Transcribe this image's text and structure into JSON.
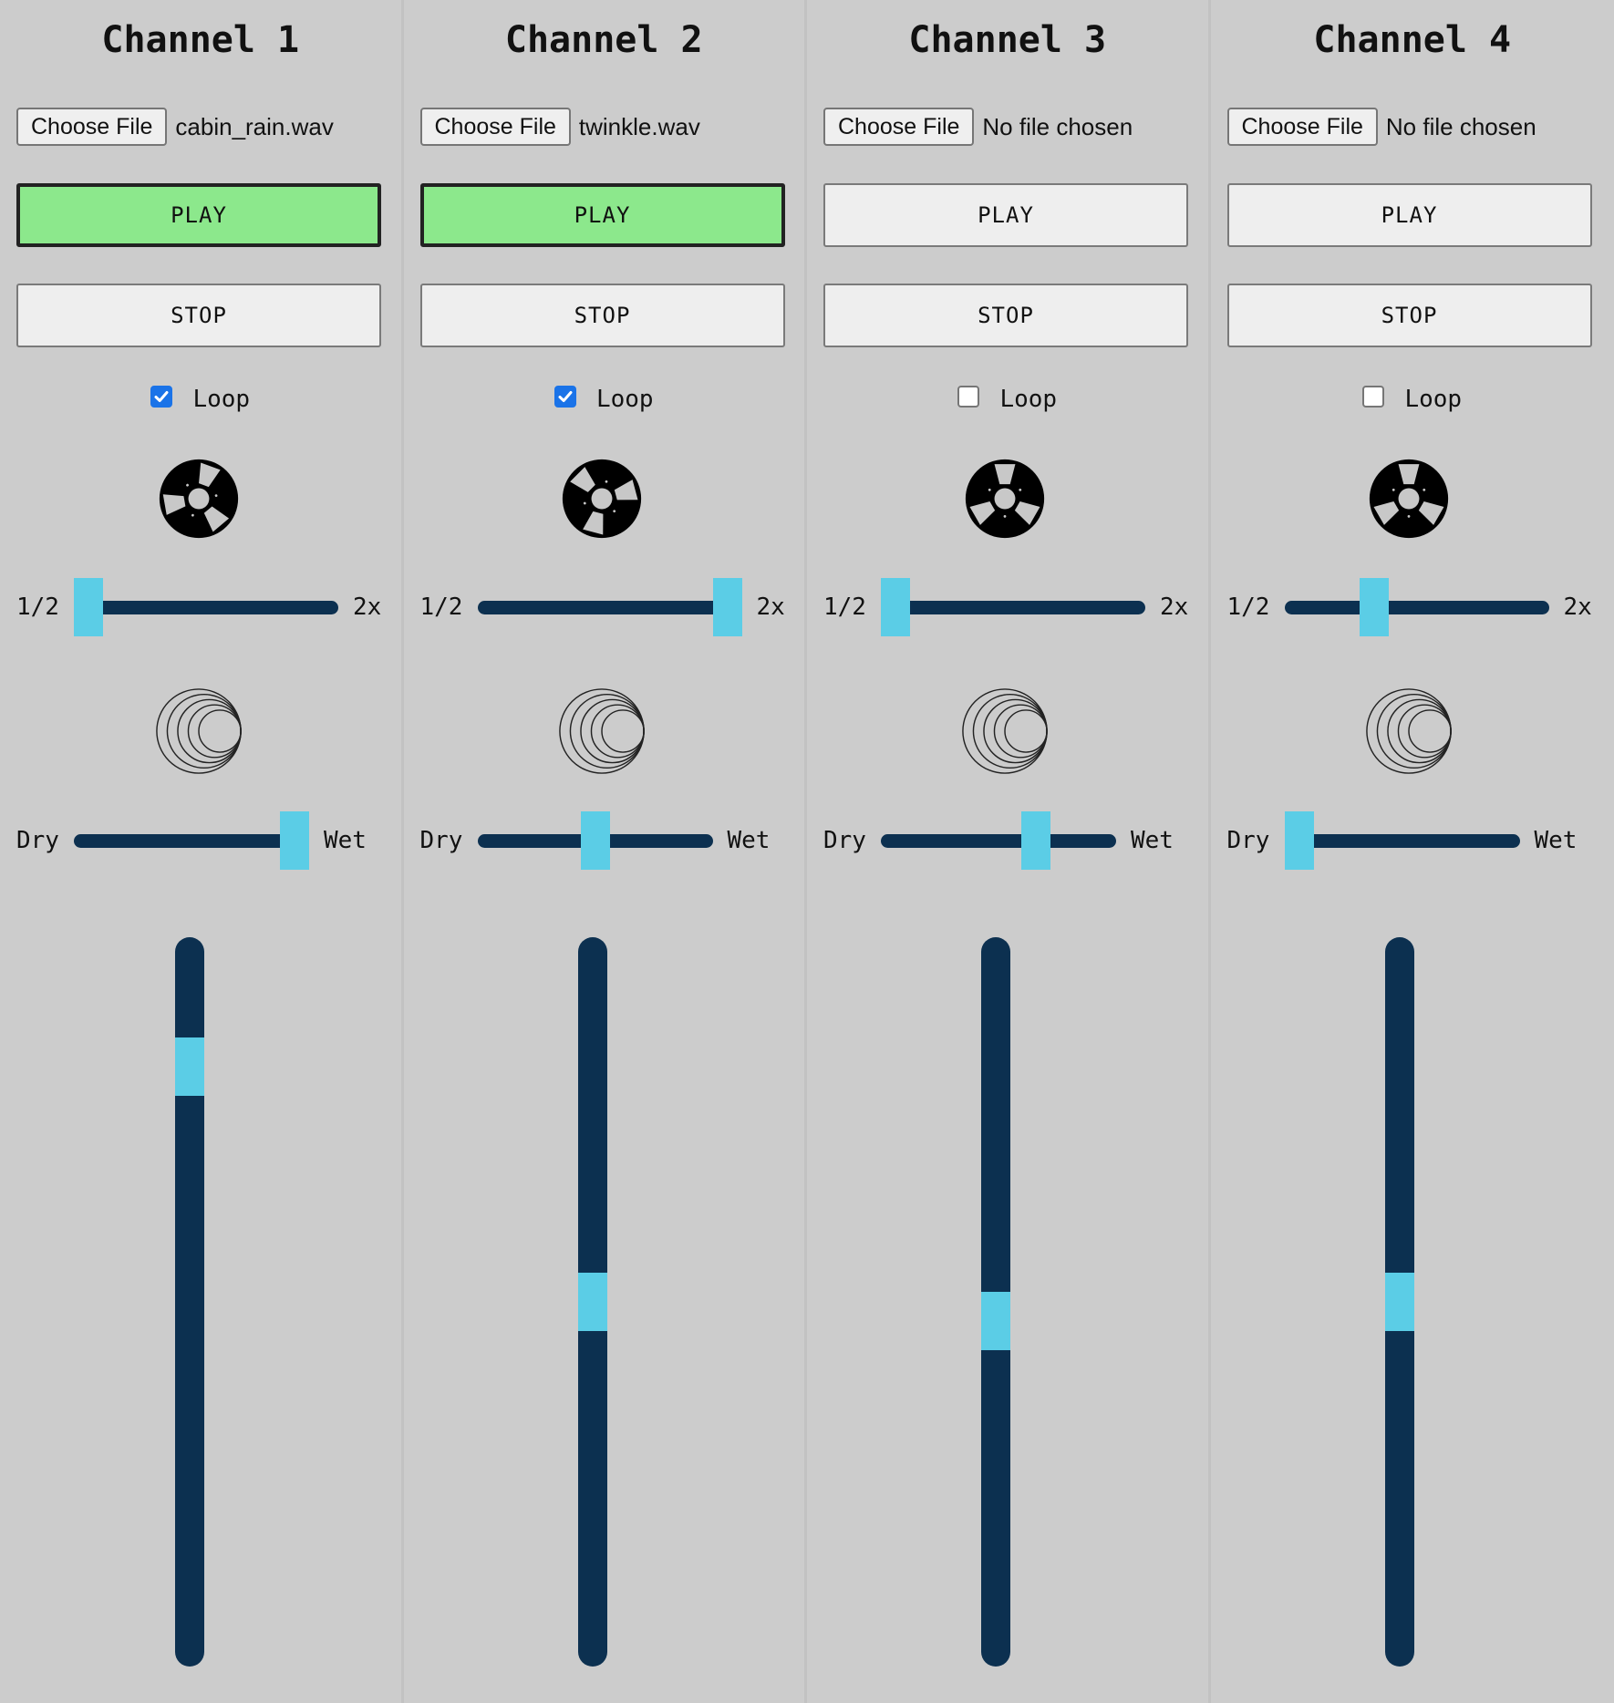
{
  "channels": [
    {
      "title": "Channel 1",
      "file_button_label": "Choose File",
      "file_name": "cabin_rain.wav",
      "play_label": "PLAY",
      "stop_label": "STOP",
      "playing": true,
      "loop_label": "Loop",
      "loop_checked": true,
      "speed_min_label": "1/2",
      "speed_max_label": "2x",
      "speed_value": 0.0,
      "reverb_min_label": "Dry",
      "reverb_max_label": "Wet",
      "reverb_value": 1.0,
      "volume_value": 0.87,
      "reel_rotation": 20
    },
    {
      "title": "Channel 2",
      "file_button_label": "Choose File",
      "file_name": "twinkle.wav",
      "play_label": "PLAY",
      "stop_label": "STOP",
      "playing": true,
      "loop_label": "Loop",
      "loop_checked": true,
      "speed_min_label": "1/2",
      "speed_max_label": "2x",
      "speed_value": 1.0,
      "reverb_min_label": "Dry",
      "reverb_max_label": "Wet",
      "reverb_value": 0.5,
      "volume_value": 0.5,
      "reel_rotation": 75
    },
    {
      "title": "Channel 3",
      "file_button_label": "Choose File",
      "file_name": "No file chosen",
      "play_label": "PLAY",
      "stop_label": "STOP",
      "playing": false,
      "loop_label": "Loop",
      "loop_checked": false,
      "speed_min_label": "1/2",
      "speed_max_label": "2x",
      "speed_value": 0.0,
      "reverb_min_label": "Dry",
      "reverb_max_label": "Wet",
      "reverb_value": 0.68,
      "volume_value": 0.47,
      "reel_rotation": 0
    },
    {
      "title": "Channel 4",
      "file_button_label": "Choose File",
      "file_name": "No file chosen",
      "play_label": "PLAY",
      "stop_label": "STOP",
      "playing": false,
      "loop_label": "Loop",
      "loop_checked": false,
      "speed_min_label": "1/2",
      "speed_max_label": "2x",
      "speed_value": 0.32,
      "reverb_min_label": "Dry",
      "reverb_max_label": "Wet",
      "reverb_value": 0.0,
      "volume_value": 0.5,
      "reel_rotation": 0
    }
  ],
  "icons": {
    "reel": "tape-reel-icon",
    "reverb": "reverb-rings-icon",
    "check": "checkmark-icon"
  },
  "colors": {
    "background": "#cccccc",
    "play_active": "#8ce88c",
    "slider_track": "#0c3050",
    "slider_thumb": "#5bcde6",
    "checkbox_checked": "#1a73e8"
  }
}
